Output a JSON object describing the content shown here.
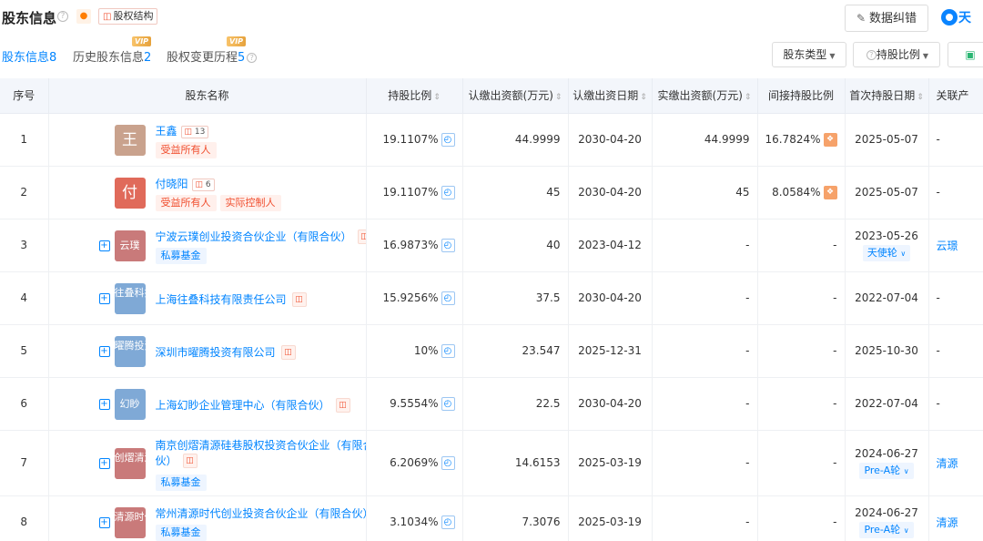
{
  "header": {
    "title": "股东信息",
    "equity_structure": "股权结构",
    "data_correction": "数据纠错",
    "logo_text": "天"
  },
  "tabs": [
    {
      "label": "股东信息",
      "count": "8",
      "vip": ""
    },
    {
      "label": "历史股东信息",
      "count": "2",
      "vip": "VIP"
    },
    {
      "label": "股权变更历程",
      "count": "5",
      "vip": "VIP"
    }
  ],
  "filters": {
    "holder_type": "股东类型",
    "holding_ratio": "持股比例"
  },
  "columns": [
    "序号",
    "股东名称",
    "持股比例",
    "认缴出资额(万元)",
    "认缴出资日期",
    "实缴出资额(万元)",
    "间接持股比例",
    "首次持股日期",
    "关联产"
  ],
  "rows": [
    {
      "no": "1",
      "avatar": "王",
      "avatar_color": "#c9a28d",
      "type": "person",
      "name": "王鑫",
      "rel_count": "13",
      "tags": [
        "受益所有人"
      ],
      "ratio": "19.1107%",
      "subscribed": "44.9999",
      "sub_date": "2030-04-20",
      "paid": "44.9999",
      "indirect": "16.7824%",
      "first_date": "2025-05-07",
      "round": "",
      "related": "-"
    },
    {
      "no": "2",
      "avatar": "付",
      "avatar_color": "#e06a5a",
      "type": "person",
      "name": "付晓阳",
      "rel_count": "6",
      "tags": [
        "受益所有人",
        "实际控制人"
      ],
      "ratio": "19.1107%",
      "subscribed": "45",
      "sub_date": "2030-04-20",
      "paid": "45",
      "indirect": "8.0584%",
      "first_date": "2025-05-07",
      "round": "",
      "related": "-"
    },
    {
      "no": "3",
      "avatar": "云璞",
      "avatar_color": "#c97a7a",
      "type": "co",
      "name": "宁波云璞创业投资合伙企业（有限合伙）",
      "rel_count": "",
      "tags": [
        "私募基金"
      ],
      "ratio": "16.9873%",
      "subscribed": "40",
      "sub_date": "2023-04-12",
      "paid": "-",
      "indirect": "-",
      "first_date": "2023-05-26",
      "round": "天使轮",
      "related": "云璟"
    },
    {
      "no": "4",
      "avatar": "往叠科技",
      "avatar_color": "#7fa9d6",
      "type": "co",
      "name": "上海往叠科技有限责任公司",
      "rel_count": "",
      "tags": [],
      "ratio": "15.9256%",
      "subscribed": "37.5",
      "sub_date": "2030-04-20",
      "paid": "-",
      "indirect": "-",
      "first_date": "2022-07-04",
      "round": "",
      "related": "-"
    },
    {
      "no": "5",
      "avatar": "曜腾投资",
      "avatar_color": "#7fa9d6",
      "type": "co",
      "name": "深圳市曜腾投资有限公司",
      "rel_count": "",
      "tags": [],
      "ratio": "10%",
      "subscribed": "23.547",
      "sub_date": "2025-12-31",
      "paid": "-",
      "indirect": "-",
      "first_date": "2025-10-30",
      "round": "",
      "related": "-"
    },
    {
      "no": "6",
      "avatar": "幻眇",
      "avatar_color": "#7fa9d6",
      "type": "co",
      "name": "上海幻眇企业管理中心（有限合伙）",
      "rel_count": "",
      "tags": [],
      "ratio": "9.5554%",
      "subscribed": "22.5",
      "sub_date": "2030-04-20",
      "paid": "-",
      "indirect": "-",
      "first_date": "2022-07-04",
      "round": "",
      "related": "-"
    },
    {
      "no": "7",
      "avatar": "创熠清源",
      "avatar_color": "#c97a7a",
      "type": "co",
      "name": "南京创熠清源硅巷股权投资合伙企业（有限合伙）",
      "rel_count": "",
      "tags": [
        "私募基金"
      ],
      "ratio": "6.2069%",
      "subscribed": "14.6153",
      "sub_date": "2025-03-19",
      "paid": "-",
      "indirect": "-",
      "first_date": "2024-06-27",
      "round": "Pre-A轮",
      "related": "清源"
    },
    {
      "no": "8",
      "avatar": "清源时代",
      "avatar_color": "#c97a7a",
      "type": "co",
      "name": "常州清源时代创业投资合伙企业（有限合伙）",
      "rel_count": "",
      "tags": [
        "私募基金"
      ],
      "ratio": "3.1034%",
      "subscribed": "7.3076",
      "sub_date": "2025-03-19",
      "paid": "-",
      "indirect": "-",
      "first_date": "2024-06-27",
      "round": "Pre-A轮",
      "related": "清源"
    }
  ]
}
